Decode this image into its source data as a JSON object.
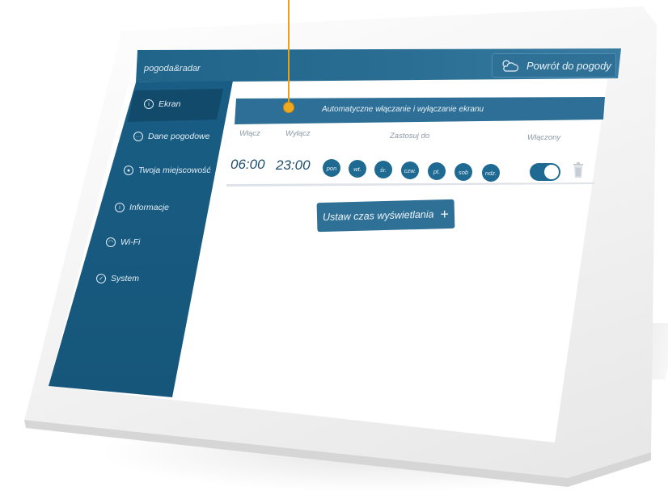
{
  "brand": "pogoda&radar",
  "back_button": {
    "label": "Powrót do pogody",
    "icon": "cloud-sun-icon"
  },
  "sidebar": {
    "items": [
      {
        "label": "Ekran",
        "icon": "screen-icon",
        "active": true
      },
      {
        "label": "Dane pogodowe",
        "icon": "data-icon"
      },
      {
        "label": "Twoja miejscowość",
        "icon": "location-icon"
      },
      {
        "label": "Informacje",
        "icon": "info-icon"
      },
      {
        "label": "Wi-Fi",
        "icon": "wifi-icon"
      },
      {
        "label": "System",
        "icon": "check-icon"
      }
    ]
  },
  "panel": {
    "title": "Automatyczne włączanie i wyłączanie ekranu",
    "columns": {
      "on": "Włącz",
      "off": "Wyłącz",
      "apply": "Zastosuj do",
      "enabled": "Włączony"
    },
    "schedule": {
      "on_time": "06:00",
      "off_time": "23:00",
      "days": [
        "pon",
        "wt.",
        "śr.",
        "czw.",
        "pt.",
        "sob",
        "ndz."
      ],
      "enabled": true
    },
    "add_button": {
      "label": "Ustaw czas wyświetlania",
      "icon": "plus-icon"
    }
  },
  "colors": {
    "primary": "#1f6a93",
    "accent": "#f0a81e",
    "sidebar": "#1a5f87"
  }
}
